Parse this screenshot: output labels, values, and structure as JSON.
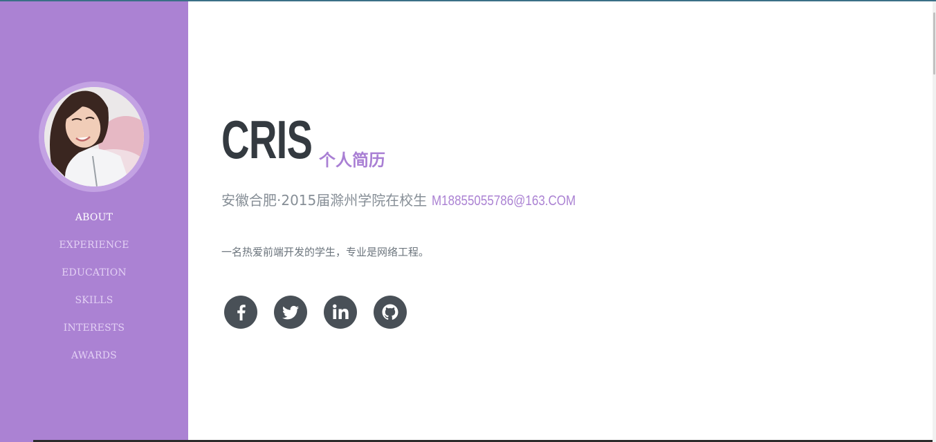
{
  "profile": {
    "name": "CRIS",
    "subtitle": "个人简历",
    "info": "安徽合肥·2015届滁州学院在校生",
    "email": "M18855055786@163.COM",
    "intro": "一名热爱前端开发的学生，专业是网络工程。"
  },
  "nav": {
    "items": [
      {
        "label": "ABOUT"
      },
      {
        "label": "EXPERIENCE"
      },
      {
        "label": "EDUCATION"
      },
      {
        "label": "SKILLS"
      },
      {
        "label": "INTERESTS"
      },
      {
        "label": "AWARDS"
      }
    ]
  },
  "socials": [
    {
      "icon": "facebook-icon"
    },
    {
      "icon": "twitter-icon"
    },
    {
      "icon": "linkedin-icon"
    },
    {
      "icon": "github-icon"
    }
  ],
  "colors": {
    "sidebar": "#ab82d3",
    "name": "#343a40",
    "accent": "#a97fd4",
    "muted": "#868e96",
    "social_bg": "#495057"
  }
}
